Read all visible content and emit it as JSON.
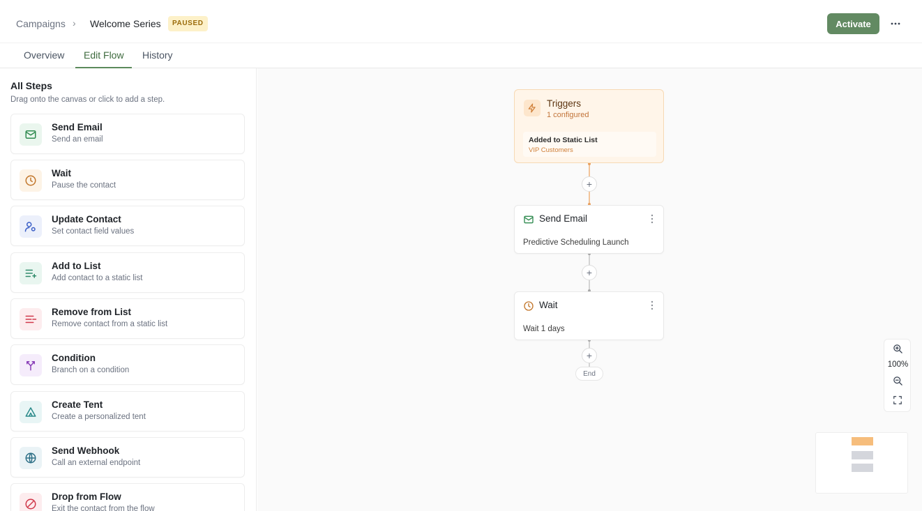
{
  "header": {
    "breadcrumb_root": "Campaigns",
    "breadcrumb_separator": "›",
    "breadcrumb_current": "Welcome Series",
    "status_badge": "PAUSED",
    "activate_label": "Activate",
    "more_label": "···"
  },
  "tabs": [
    {
      "label": "Overview",
      "active": false
    },
    {
      "label": "Edit Flow",
      "active": true
    },
    {
      "label": "History",
      "active": false
    }
  ],
  "sidebar": {
    "title": "All Steps",
    "subtitle": "Drag onto the canvas or click to add a step.",
    "steps": [
      {
        "name": "Send Email",
        "desc": "Send an email",
        "icon": "mail-icon",
        "color": "#2f8a4f",
        "bg": "#eaf6ee"
      },
      {
        "name": "Wait",
        "desc": "Pause the contact",
        "icon": "clock-icon",
        "color": "#c2762b",
        "bg": "#fdf3e6"
      },
      {
        "name": "Update Contact",
        "desc": "Set contact field values",
        "icon": "user-settings-icon",
        "color": "#3b5fc7",
        "bg": "#ecf0fb"
      },
      {
        "name": "Add to List",
        "desc": "Add contact to a static list",
        "icon": "list-plus-icon",
        "color": "#2f8a6a",
        "bg": "#e9f6f0"
      },
      {
        "name": "Remove from List",
        "desc": "Remove contact from a static list",
        "icon": "list-minus-icon",
        "color": "#d0384a",
        "bg": "#fdecee"
      },
      {
        "name": "Condition",
        "desc": "Branch on a condition",
        "icon": "branch-icon",
        "color": "#8a3fb8",
        "bg": "#f5ecfb"
      },
      {
        "name": "Create Tent",
        "desc": "Create a personalized tent",
        "icon": "tent-icon",
        "color": "#2b8a8a",
        "bg": "#e8f5f5"
      },
      {
        "name": "Send Webhook",
        "desc": "Call an external endpoint",
        "icon": "globe-icon",
        "color": "#2d6f86",
        "bg": "#eaf3f6"
      },
      {
        "name": "Drop from Flow",
        "desc": "Exit the contact from the flow",
        "icon": "ban-icon",
        "color": "#d0384a",
        "bg": "#fdecee"
      }
    ]
  },
  "canvas": {
    "trigger": {
      "title": "Triggers",
      "count": "1 configured",
      "item_title": "Added to Static List",
      "item_sub": "VIP Customers"
    },
    "nodes": [
      {
        "title": "Send Email",
        "desc": "Predictive Scheduling Launch",
        "icon": "mail-icon"
      },
      {
        "title": "Wait",
        "desc": "Wait 1 days",
        "icon": "clock-icon"
      }
    ],
    "end_label": "End",
    "zoom_level": "100%"
  },
  "colors": {
    "accent": "#628a62",
    "trigger_bg": "#fff5e9",
    "paused_badge": "#fdf1c9"
  }
}
